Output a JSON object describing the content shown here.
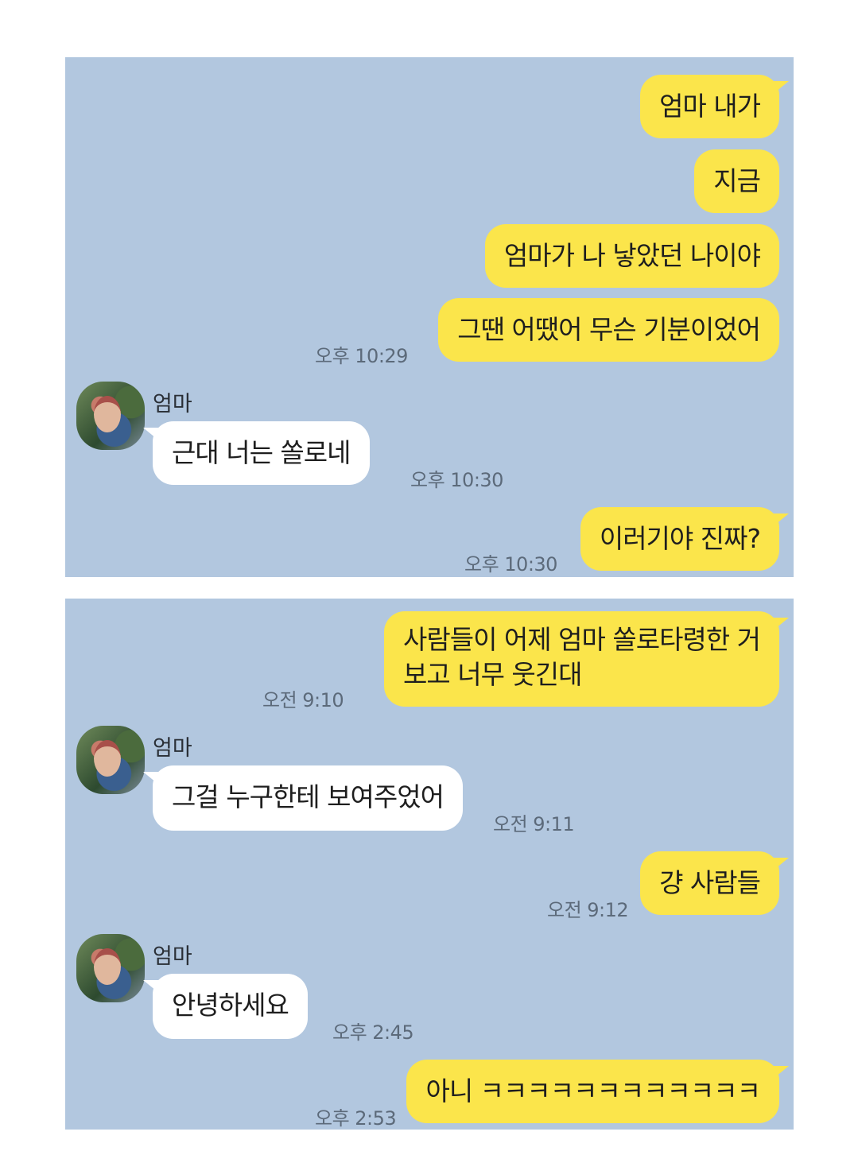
{
  "screen1": {
    "sent_1": "엄마 내가",
    "sent_2": "지금",
    "sent_3": "엄마가 나 낳았던 나이야",
    "sent_4": "그땐 어땠어 무슨 기분이었어",
    "sent_time_1": "오후 10:29",
    "contact_name": "엄마",
    "recv_1": "근대 너는    쏠로네",
    "recv_time_1": "오후 10:30",
    "sent_5": "이러기야 진짜?",
    "sent_time_2": "오후 10:30"
  },
  "screen2": {
    "sent_1_line1": "사람들이 어제 엄마 쏠로타령한 거",
    "sent_1_line2": "보고 너무 웃긴대",
    "sent_time_1": "오전 9:10",
    "contact_name_1": "엄마",
    "recv_1": "그걸 누구한테 보여주었어",
    "recv_time_1": "오전 9:11",
    "sent_2": "걍 사람들",
    "sent_time_2": "오전 9:12",
    "contact_name_2": "엄마",
    "recv_2": "안녕하세요",
    "recv_time_2": "오후 2:45",
    "sent_3": "아니 ㅋㅋㅋㅋㅋㅋㅋㅋㅋㅋㅋㅋ",
    "sent_time_3": "오후 2:53"
  },
  "colors": {
    "background": "#b2c7df",
    "my_bubble": "#fbe54b",
    "their_bubble": "#ffffff",
    "timestamp": "#5c6a7a"
  },
  "icons": {
    "contact_avatar": "mom-profile-photo"
  }
}
